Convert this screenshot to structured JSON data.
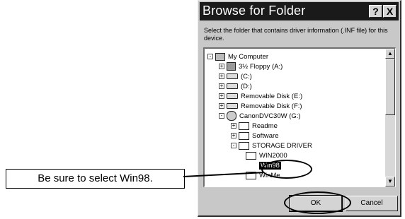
{
  "dialog": {
    "title": "Browse for Folder",
    "help_label": "?",
    "close_label": "X",
    "prompt": "Select the folder that contains driver information (.INF file) for this device.",
    "ok_label": "OK",
    "cancel_label": "Cancel"
  },
  "tree": {
    "items": [
      {
        "label": "My Computer",
        "expander": "-",
        "icon": "computer-icon"
      },
      {
        "label": "3½ Floppy (A:)",
        "expander": "+",
        "icon": "floppy-drive-icon"
      },
      {
        "label": "(C:)",
        "expander": "+",
        "icon": "hard-drive-icon"
      },
      {
        "label": "(D:)",
        "expander": "+",
        "icon": "hard-drive-icon"
      },
      {
        "label": "Removable Disk (E:)",
        "expander": "+",
        "icon": "removable-disk-icon"
      },
      {
        "label": "Removable Disk (F:)",
        "expander": "+",
        "icon": "removable-disk-icon"
      },
      {
        "label": "CanonDVC30W (G:)",
        "expander": "-",
        "icon": "camera-drive-icon"
      },
      {
        "label": "Readme",
        "expander": "+",
        "icon": "folder-icon"
      },
      {
        "label": "Software",
        "expander": "+",
        "icon": "folder-icon"
      },
      {
        "label": "STORAGE DRIVER",
        "expander": "-",
        "icon": "folder-icon"
      },
      {
        "label": "WIN2000",
        "expander": "",
        "icon": "folder-icon"
      },
      {
        "label": "Win98",
        "expander": "",
        "icon": "open-folder-icon",
        "selected": true
      },
      {
        "label": "WinMe",
        "expander": "",
        "icon": "folder-icon"
      }
    ],
    "scroll_up": "▲",
    "scroll_down": "▼"
  },
  "annotation": {
    "callout_text": "Be sure to select Win98."
  }
}
